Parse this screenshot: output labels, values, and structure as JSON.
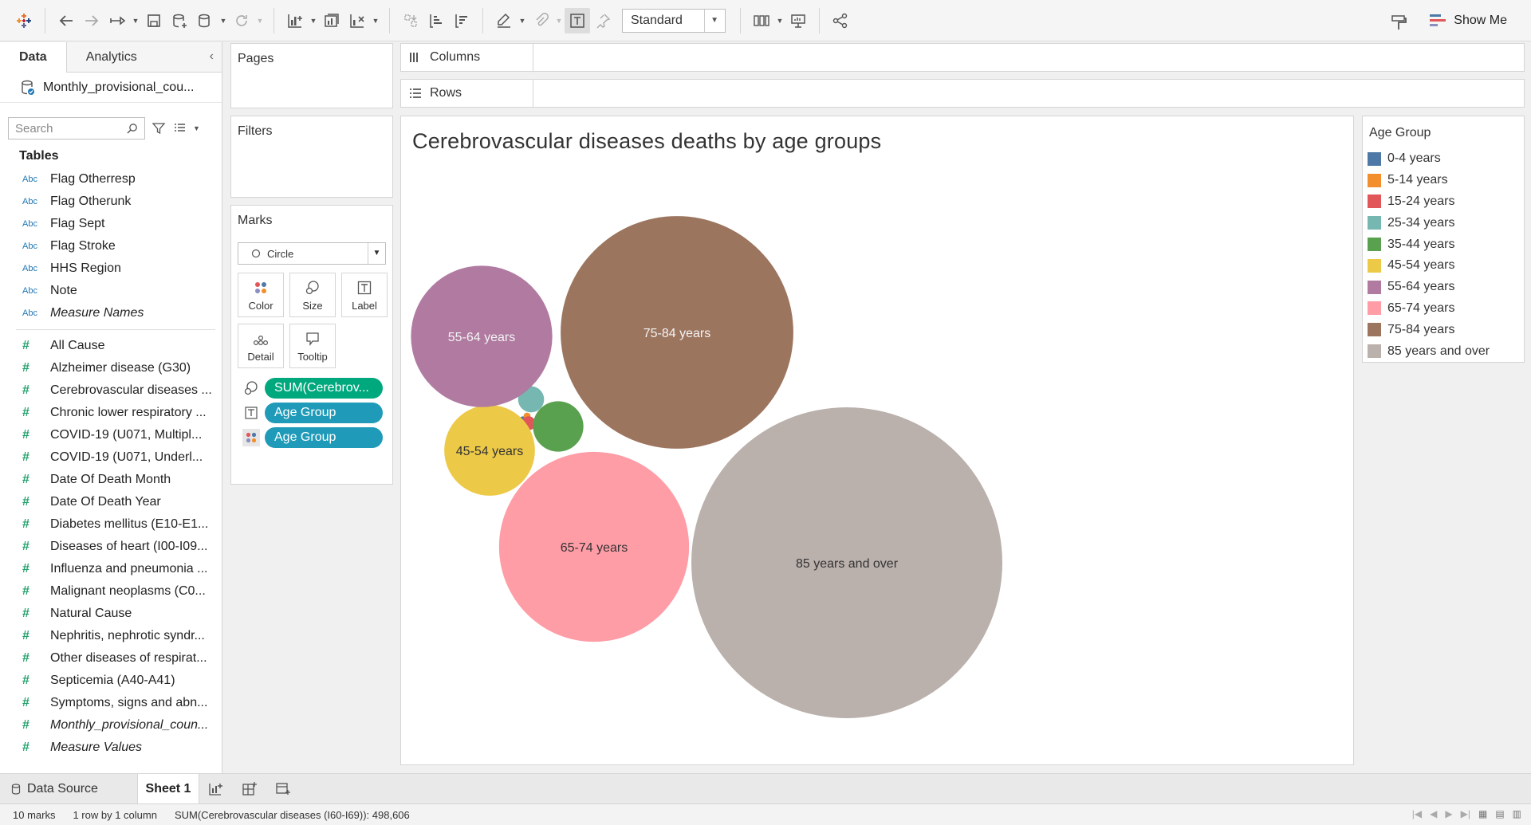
{
  "toolbar": {
    "format_select": "Standard",
    "show_me_label": "Show Me"
  },
  "data_pane": {
    "tabs": [
      "Data",
      "Analytics"
    ],
    "datasource": "Monthly_provisional_cou...",
    "search_placeholder": "Search",
    "tables_title": "Tables",
    "dimensions": [
      {
        "type": "Abc",
        "name": "Flag Otherresp",
        "italic": false
      },
      {
        "type": "Abc",
        "name": "Flag Otherunk",
        "italic": false
      },
      {
        "type": "Abc",
        "name": "Flag Sept",
        "italic": false
      },
      {
        "type": "Abc",
        "name": "Flag Stroke",
        "italic": false
      },
      {
        "type": "Abc",
        "name": "HHS Region",
        "italic": false
      },
      {
        "type": "Abc",
        "name": "Note",
        "italic": false
      },
      {
        "type": "Abc",
        "name": "Measure Names",
        "italic": true
      }
    ],
    "measures": [
      {
        "type": "#",
        "name": "All Cause",
        "italic": false
      },
      {
        "type": "#",
        "name": "Alzheimer disease (G30)",
        "italic": false
      },
      {
        "type": "#",
        "name": "Cerebrovascular diseases ...",
        "italic": false
      },
      {
        "type": "#",
        "name": "Chronic lower respiratory ...",
        "italic": false
      },
      {
        "type": "#",
        "name": "COVID-19 (U071, Multipl...",
        "italic": false
      },
      {
        "type": "#",
        "name": "COVID-19 (U071, Underl...",
        "italic": false
      },
      {
        "type": "#",
        "name": "Date Of Death Month",
        "italic": false
      },
      {
        "type": "#",
        "name": "Date Of Death Year",
        "italic": false
      },
      {
        "type": "#",
        "name": "Diabetes mellitus (E10-E1...",
        "italic": false
      },
      {
        "type": "#",
        "name": "Diseases of heart (I00-I09...",
        "italic": false
      },
      {
        "type": "#",
        "name": "Influenza and pneumonia ...",
        "italic": false
      },
      {
        "type": "#",
        "name": "Malignant neoplasms (C0...",
        "italic": false
      },
      {
        "type": "#",
        "name": "Natural Cause",
        "italic": false
      },
      {
        "type": "#",
        "name": "Nephritis, nephrotic syndr...",
        "italic": false
      },
      {
        "type": "#",
        "name": "Other diseases of respirat...",
        "italic": false
      },
      {
        "type": "#",
        "name": "Septicemia (A40-A41)",
        "italic": false
      },
      {
        "type": "#",
        "name": "Symptoms, signs and abn...",
        "italic": false
      },
      {
        "type": "#",
        "name": "Monthly_provisional_coun...",
        "italic": true
      },
      {
        "type": "#",
        "name": "Measure Values",
        "italic": true
      }
    ]
  },
  "cards": {
    "pages": "Pages",
    "filters": "Filters",
    "marks": "Marks",
    "mark_type": "Circle",
    "buttons": [
      "Color",
      "Size",
      "Label",
      "Detail",
      "Tooltip"
    ],
    "pills": [
      "SUM(Cerebrov...",
      "Age Group",
      "Age Group"
    ]
  },
  "shelves": {
    "columns": "Columns",
    "rows": "Rows"
  },
  "chart_data": {
    "type": "bubble",
    "title": "Cerebrovascular diseases deaths by age groups",
    "total": 498606,
    "categories": [
      "0-4 years",
      "5-14 years",
      "15-24 years",
      "25-34 years",
      "35-44 years",
      "45-54 years",
      "55-64 years",
      "65-74 years",
      "75-84 years",
      "85 years and over"
    ],
    "colors": [
      "#4e79a7",
      "#f28e2b",
      "#e15759",
      "#76b7b2",
      "#59a14f",
      "#edc948",
      "#b07aa1",
      "#ff9da7",
      "#9c755f",
      "#bab0ac"
    ],
    "values": [
      250,
      150,
      600,
      2100,
      7900,
      25500,
      62000,
      112000,
      168000,
      300000
    ],
    "labels_shown": [
      false,
      false,
      false,
      false,
      false,
      true,
      true,
      true,
      true,
      true
    ]
  },
  "legend": {
    "title": "Age Group",
    "items": [
      "0-4 years",
      "5-14 years",
      "15-24 years",
      "25-34 years",
      "35-44 years",
      "45-54 years",
      "55-64 years",
      "65-74 years",
      "75-84 years",
      "85 years and over"
    ]
  },
  "tabs": {
    "data_source": "Data Source",
    "sheet": "Sheet 1"
  },
  "status": {
    "marks": "10 marks",
    "dims": "1 row by 1 column",
    "sum": "SUM(Cerebrovascular diseases (I60-I69)): 498,606"
  }
}
